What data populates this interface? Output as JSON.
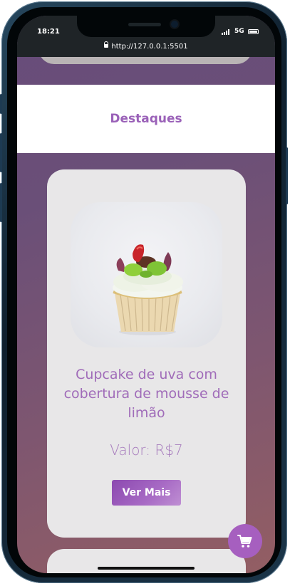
{
  "status_bar": {
    "time": "18:21",
    "network": "5G",
    "url": "http://127.0.0.1:5501"
  },
  "header": {
    "title": "Destaques"
  },
  "product": {
    "name": "Cupcake de uva com cobertura de mousse de limão",
    "price": "Valor: R$7",
    "button_label": "Ver Mais",
    "image_icon": "cupcake-photo"
  },
  "cart_button": {
    "icon": "cart-icon"
  },
  "colors": {
    "accent": "#a06cb9",
    "button": "#9b5bbb",
    "background_top": "#684c7a",
    "background_bottom": "#935e63"
  }
}
